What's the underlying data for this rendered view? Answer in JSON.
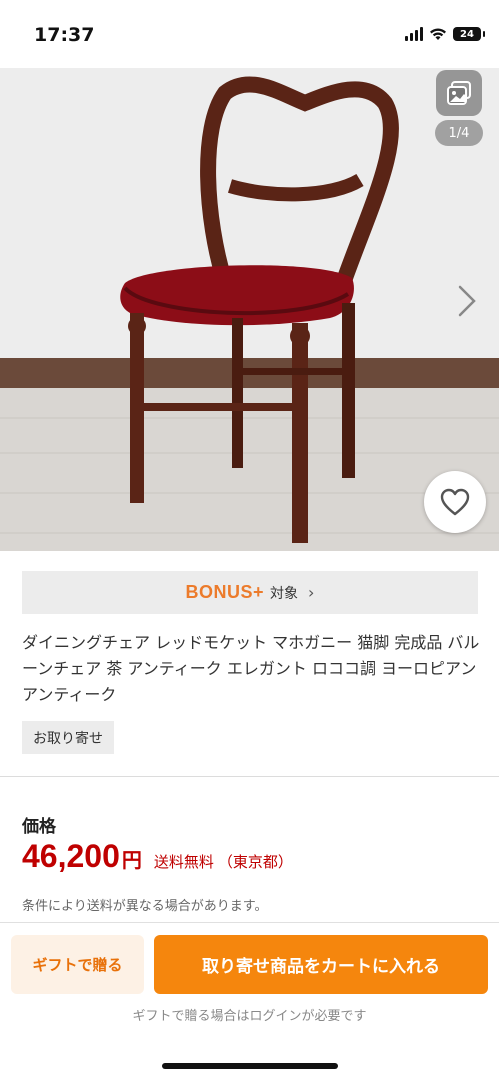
{
  "status_bar": {
    "time": "17:37",
    "battery": "24"
  },
  "gallery": {
    "counter": "1/4",
    "icon": "image-gallery-icon"
  },
  "bonus": {
    "logo": "BONUS+",
    "label": "対象",
    "chevron": "›"
  },
  "product": {
    "title": "ダイニングチェア レッドモケット マホガニー 猫脚 完成品 バルーンチェア 茶 アンティーク エレガント ロココ調 ヨーロピアン アンティーク",
    "tag": "お取り寄せ"
  },
  "price": {
    "label": "価格",
    "value": "46,200",
    "unit": "円",
    "shipping": "送料無料",
    "region": "（東京都）",
    "note": "条件により送料が異なる場合があります。"
  },
  "actions": {
    "gift_label": "ギフトで贈る",
    "cart_label": "取り寄せ商品をカートに入れる",
    "login_note": "ギフトで贈る場合はログインが必要です"
  },
  "colors": {
    "accent": "#f5860d",
    "price": "#bf0000",
    "bonus": "#ec7b2b"
  }
}
